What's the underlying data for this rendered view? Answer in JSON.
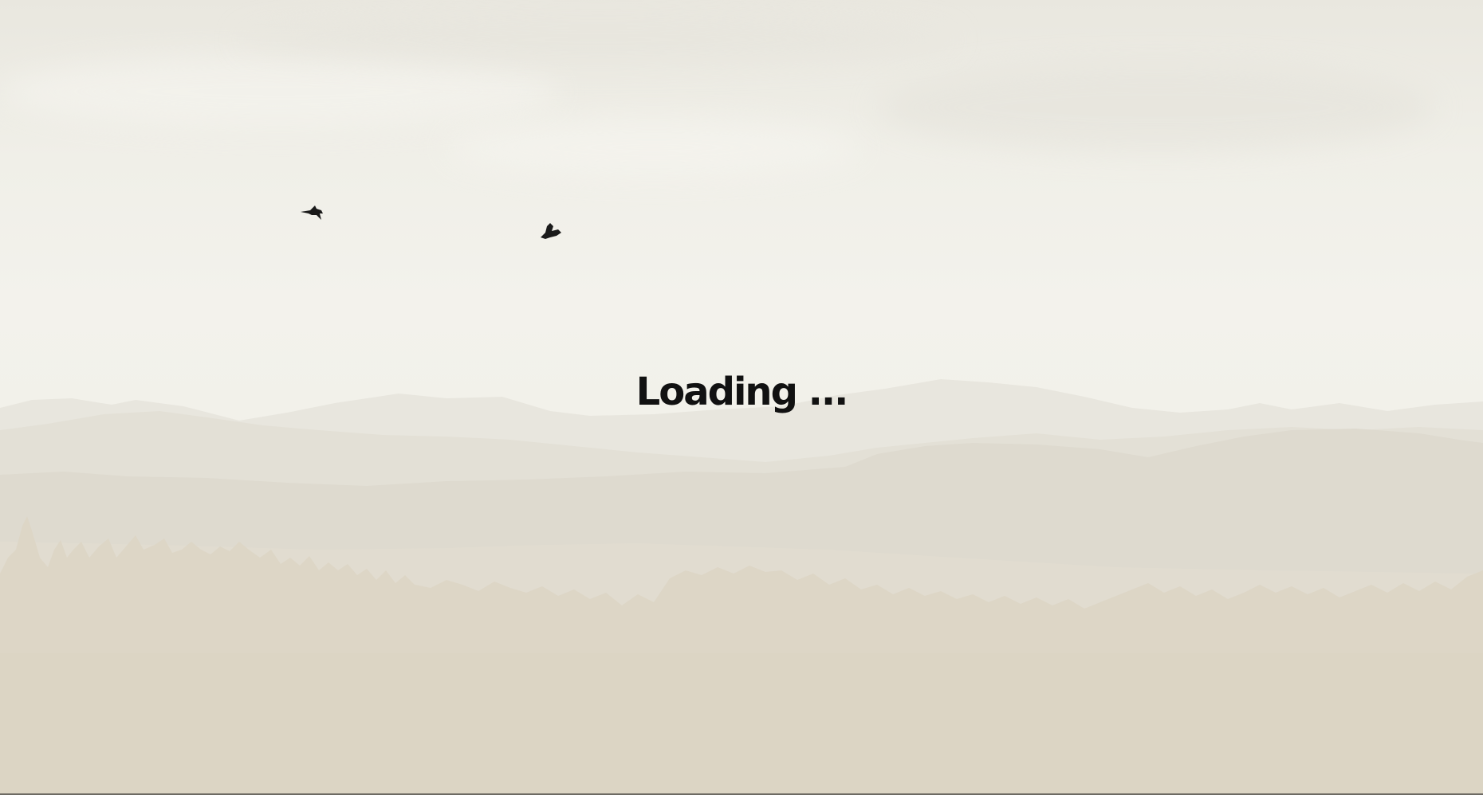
{
  "loading": {
    "text": "Loading ..."
  },
  "background": {
    "description_icon": "misty-forest-landscape",
    "colors": {
      "sky": "#f2f1ea",
      "mountain_far": "#e6e4dc",
      "mountain_mid": "#e1ddd1",
      "forest": "#ddd7c8",
      "text": "#111111"
    }
  },
  "birds": [
    {
      "icon": "bird-icon"
    },
    {
      "icon": "bird-icon"
    }
  ]
}
